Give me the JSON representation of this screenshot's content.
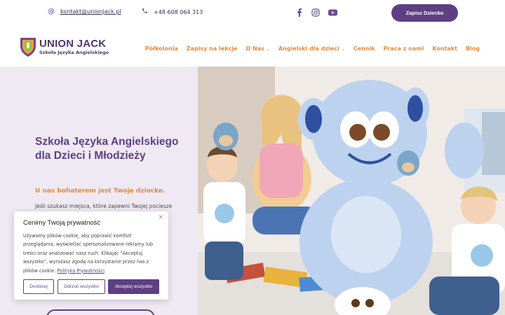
{
  "topbar": {
    "email": "kontakt@unionjack.pl",
    "phone": "+48 608 064 313",
    "social": [
      "facebook-icon",
      "instagram-icon",
      "youtube-icon"
    ],
    "cta_label": "Zapisz Dziecko"
  },
  "brand": {
    "name": "UNION JACK",
    "subtitle": "Szkoła Języka Angielskiego"
  },
  "nav": {
    "items": [
      {
        "label": "Półkolonia",
        "dropdown": false
      },
      {
        "label": "Zapisy na lekcje",
        "dropdown": false
      },
      {
        "label": "O Nas",
        "dropdown": true
      },
      {
        "label": "Angielski dla dzieci",
        "dropdown": true
      },
      {
        "label": "Cennik",
        "dropdown": false
      },
      {
        "label": "Praca z nami",
        "dropdown": false
      },
      {
        "label": "Kontakt",
        "dropdown": false
      },
      {
        "label": "Blog",
        "dropdown": false
      }
    ]
  },
  "hero": {
    "title": "Szkoła Języka Angielskiego dla Dzieci i Młodzieży",
    "tagline": "U nas bohaterem jest Twoje dziecko.",
    "paragraph_start": "Jeśli szukasz miejsca, które zapewni Twojej pociesze"
  },
  "cookie": {
    "title": "Cenimy Twoją prywatność",
    "body": "Używamy plików cookie, aby poprawić komfort przeglądania, wyświetlać spersonalizowane reklamy lub treści oraz analizować nasz ruch. Klikając \"Akceptuj wszystko\", wyrażasz zgodę na korzystanie przez nas z plików cookie.",
    "policy_link": "Polityka Prywatności",
    "customize_label": "Dostosuj",
    "reject_label": "Odrzuć wszystko",
    "accept_label": "Akceptuj wszystko"
  },
  "colors": {
    "brand_purple": "#5e3f83",
    "accent_orange": "#e38a3b",
    "hero_bg": "#efe9f3"
  }
}
